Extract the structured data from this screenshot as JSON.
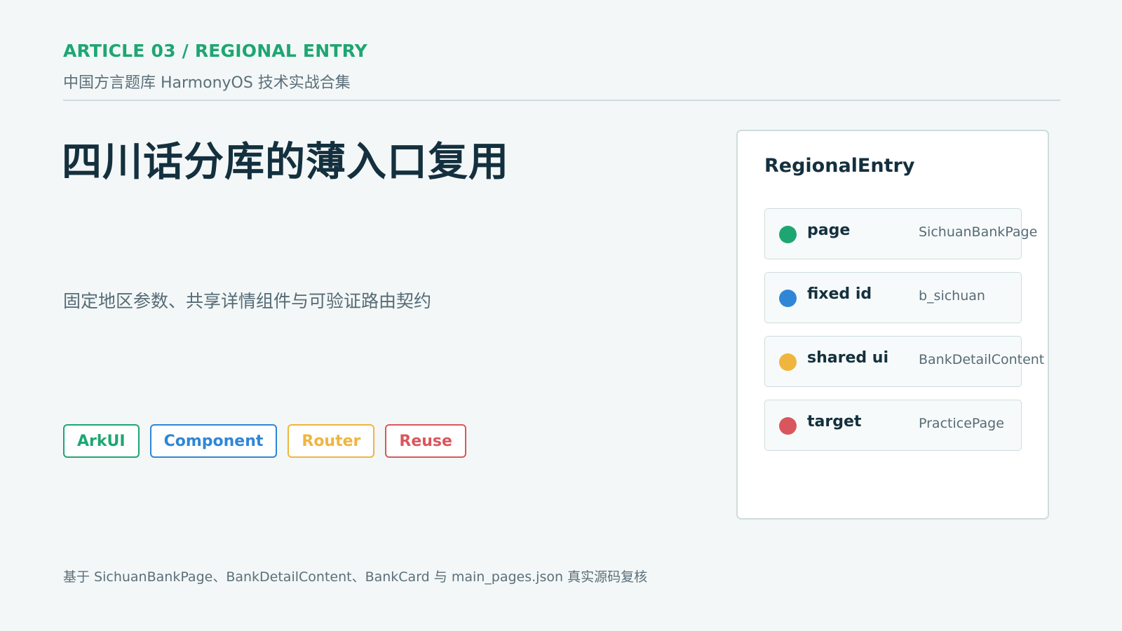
{
  "header": {
    "kicker": "ARTICLE 03 / REGIONAL ENTRY",
    "subtitle": "中国方言题库 HarmonyOS 技术实战合集"
  },
  "main": {
    "title": "四川话分库的薄入口复用",
    "summary": "固定地区参数、共享详情组件与可验证路由契约"
  },
  "tags": [
    {
      "label": "ArkUI",
      "color": "#1ea672"
    },
    {
      "label": "Component",
      "color": "#2f86d6"
    },
    {
      "label": "Router",
      "color": "#f0b53f"
    },
    {
      "label": "Reuse",
      "color": "#d9575c"
    }
  ],
  "panel": {
    "title": "RegionalEntry",
    "rows": [
      {
        "key": "page",
        "value": "SichuanBankPage",
        "color": "#1ea672"
      },
      {
        "key": "fixed id",
        "value": "b_sichuan",
        "color": "#2f86d6"
      },
      {
        "key": "shared ui",
        "value": "BankDetailContent",
        "color": "#f0b53f"
      },
      {
        "key": "target",
        "value": "PracticePage",
        "color": "#d9575c"
      }
    ]
  },
  "footer": {
    "text": "基于 SichuanBankPage、BankDetailContent、BankCard 与 main_pages.json 真实源码复核"
  }
}
